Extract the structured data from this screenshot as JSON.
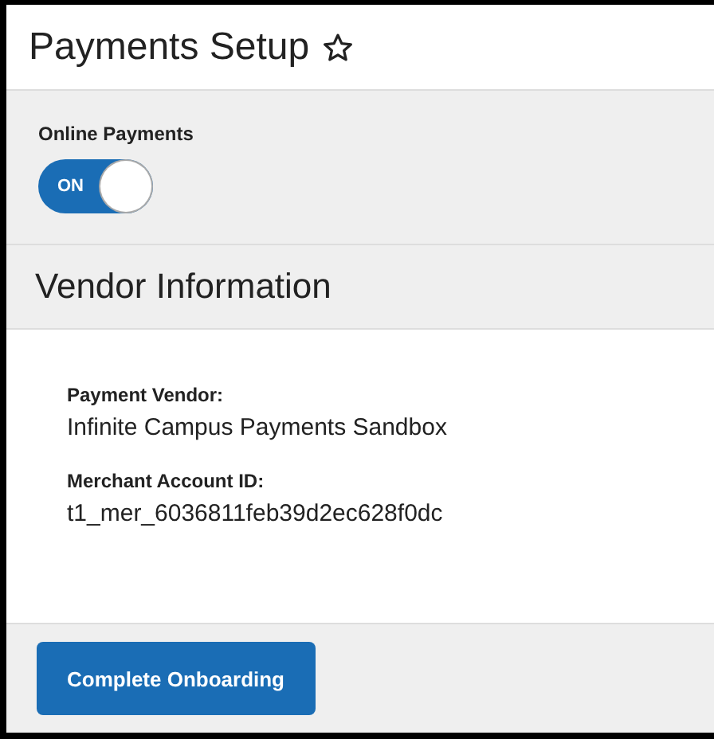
{
  "page": {
    "title": "Payments Setup",
    "favorite": false
  },
  "online_payments": {
    "label": "Online Payments",
    "toggle": {
      "label": "ON",
      "on": true
    }
  },
  "vendor_section": {
    "title": "Vendor Information",
    "fields": [
      {
        "label": "Payment Vendor:",
        "value": "Infinite Campus Payments Sandbox"
      },
      {
        "label": "Merchant Account ID:",
        "value": "t1_mer_6036811feb39d2ec628f0dc"
      }
    ]
  },
  "buttons": [
    "Complete Onboarding"
  ]
}
